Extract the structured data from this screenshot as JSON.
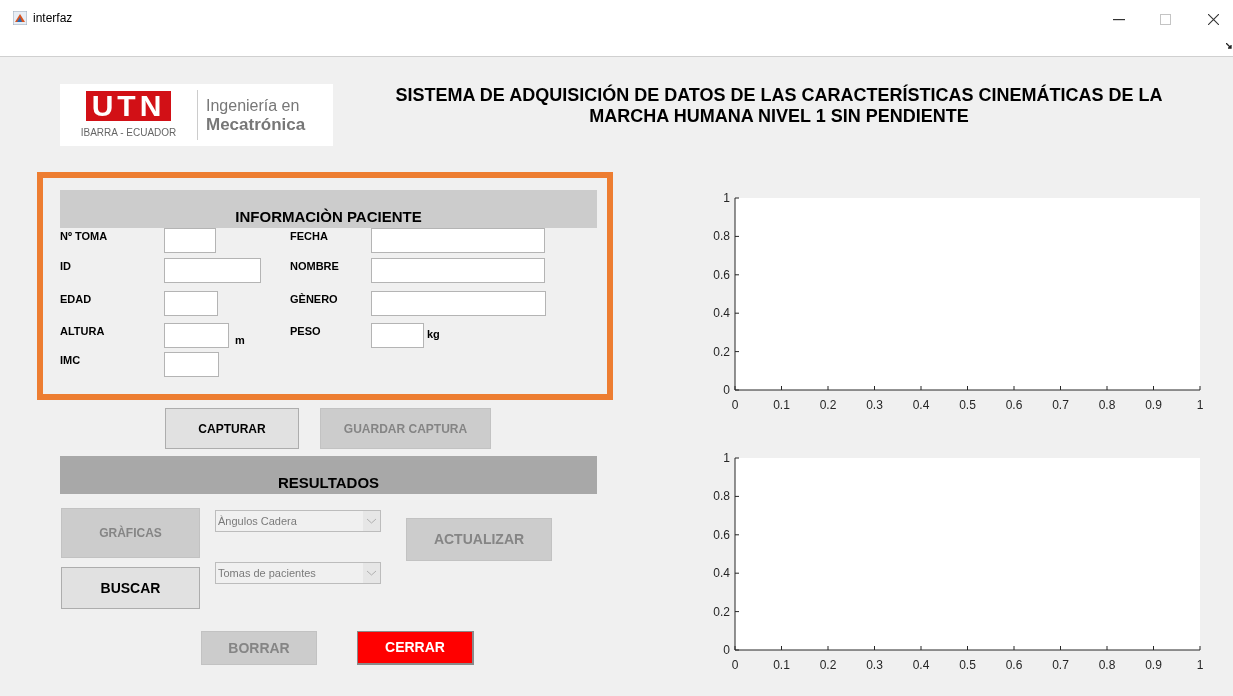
{
  "window": {
    "title": "interfaz"
  },
  "logo": {
    "mark": "UTN",
    "place": "IBARRA - ECUADOR",
    "line_1": "Ingeniería en",
    "line_2": "Mecatrónica"
  },
  "title": "SISTEMA DE ADQUISICIÓN DE DATOS DE LAS CARACTERÍSTICAS CINEMÁTICAS DE LA MARCHA HUMANA NIVEL 1 SIN PENDIENTE",
  "patient_panel": {
    "heading": "INFORMACIÒN PACIENTE",
    "rows": [
      {
        "left": {
          "label": "Nº TOMA"
        },
        "right": {
          "label": "FECHA"
        }
      },
      {
        "left": {
          "label": "ID"
        },
        "right": {
          "label": "NOMBRE"
        }
      },
      {
        "left": {
          "label": "EDAD"
        },
        "right": {
          "label": "GÈNERO"
        }
      },
      {
        "left": {
          "label": "ALTURA",
          "unit": "m"
        },
        "right": {
          "label": "PESO",
          "unit": "kg"
        }
      },
      {
        "left": {
          "label": "IMC"
        }
      }
    ]
  },
  "capture_buttons": [
    {
      "label": "CAPTURAR",
      "disabled": false
    },
    {
      "label": "GUARDAR CAPTURA",
      "disabled": true
    }
  ],
  "results": {
    "heading": "RESULTADOS",
    "graphs_button": {
      "label": "GRÀFICAS",
      "disabled": true
    },
    "search_button": {
      "label": "BUSCAR",
      "disabled": false
    },
    "dropdowns": [
      {
        "value": "Àngulos Cadera",
        "disabled": true
      },
      {
        "value": "Tomas de pacientes",
        "disabled": true
      }
    ],
    "update_button": {
      "label": "ACTUALIZAR",
      "disabled": true
    }
  },
  "bottom_buttons": [
    {
      "label": "BORRAR",
      "kind": "normal",
      "disabled": true
    },
    {
      "label": "CERRAR",
      "kind": "danger",
      "disabled": false
    }
  ],
  "charts": [
    {
      "chart_data": {
        "type": "line",
        "xlim": [
          0,
          1
        ],
        "ylim": [
          0,
          1
        ],
        "xticks": [
          0,
          0.1,
          0.2,
          0.3,
          0.4,
          0.5,
          0.6,
          0.7,
          0.8,
          0.9,
          1
        ],
        "yticks": [
          0,
          0.2,
          0.4,
          0.6,
          0.8,
          1
        ]
      }
    },
    {
      "chart_data": {
        "type": "line",
        "xlim": [
          0,
          1
        ],
        "ylim": [
          0,
          1
        ],
        "xticks": [
          0,
          0.1,
          0.2,
          0.3,
          0.4,
          0.5,
          0.6,
          0.7,
          0.8,
          0.9,
          1
        ],
        "yticks": [
          0,
          0.2,
          0.4,
          0.6,
          0.8,
          1
        ]
      }
    }
  ]
}
